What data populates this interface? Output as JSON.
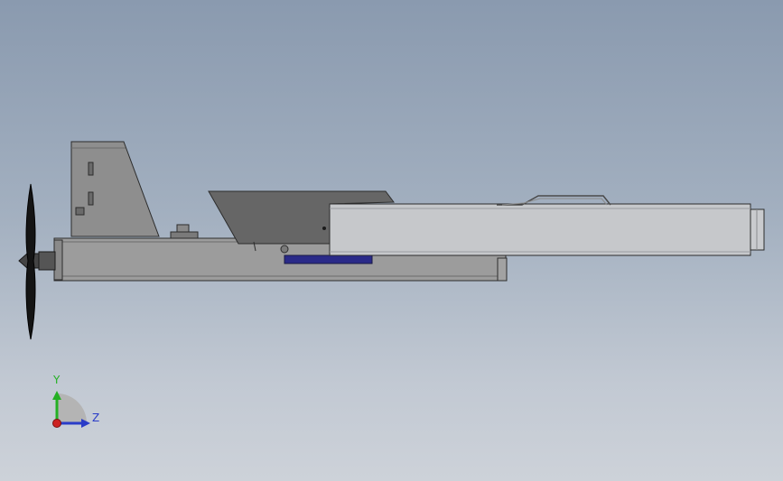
{
  "viewport": {
    "background_top": "#8a9aaf",
    "background_bottom": "#cdd2d9"
  },
  "model": {
    "body_color": "#9c9c9c",
    "body_shade": "#8a8a8a",
    "dark_part_color": "#666666",
    "light_panel_color": "#c6c8cb",
    "accent_part_color": "#2a2a88",
    "propeller_color": "#141414",
    "edge_color": "#2c2c2c"
  },
  "triad": {
    "y_label": "Y",
    "z_label": "Z",
    "y_color": "#24b024",
    "z_color": "#2a3cc8",
    "origin_color": "#cc2222"
  }
}
